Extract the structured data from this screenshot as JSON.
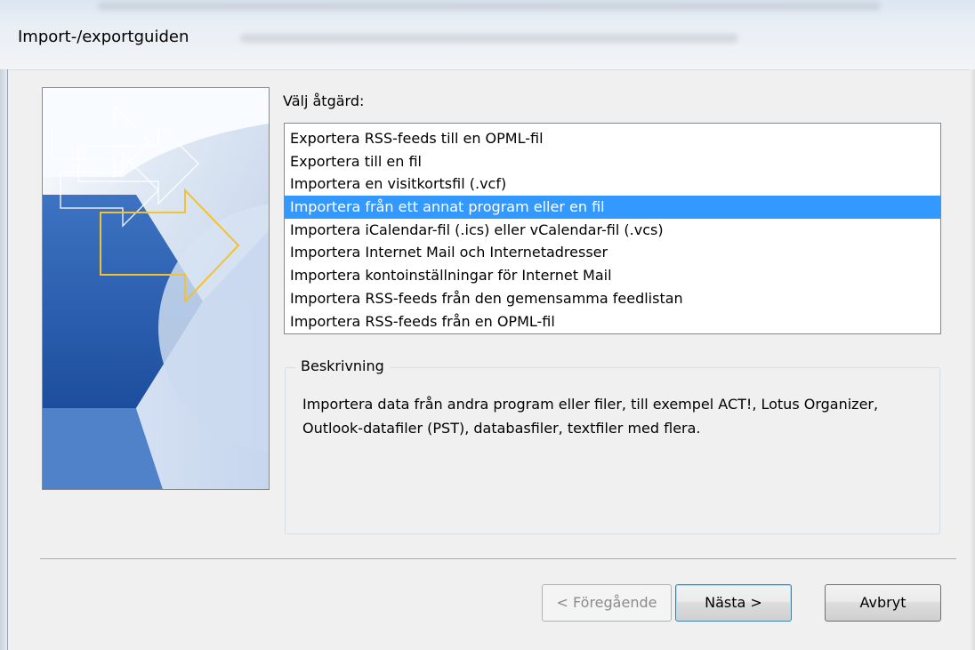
{
  "window": {
    "title": "Import-/exportguiden"
  },
  "main": {
    "choose_label": "Välj åtgärd:",
    "actions": [
      "Exportera RSS-feeds till en OPML-fil",
      "Exportera till en fil",
      "Importera en visitkortsfil (.vcf)",
      "Importera från ett annat program eller en fil",
      "Importera iCalendar-fil (.ics) eller vCalendar-fil (.vcs)",
      "Importera Internet Mail och Internetadresser",
      "Importera kontoinställningar för Internet Mail",
      "Importera RSS-feeds från den gemensamma feedlistan",
      "Importera RSS-feeds från en OPML-fil"
    ],
    "selected_index": 3,
    "description_legend": "Beskrivning",
    "description_text": "Importera data från andra program eller filer, till exempel ACT!, Lotus Organizer, Outlook-datafiler (PST), databasfiler, textfiler med flera."
  },
  "buttons": {
    "back": "< Föregående",
    "next": "Nästa >",
    "cancel": "Avbryt"
  },
  "colors": {
    "selection": "#3399ff",
    "banner_blue": "#2a5ca8",
    "arrow_outline": "#f2c230"
  }
}
